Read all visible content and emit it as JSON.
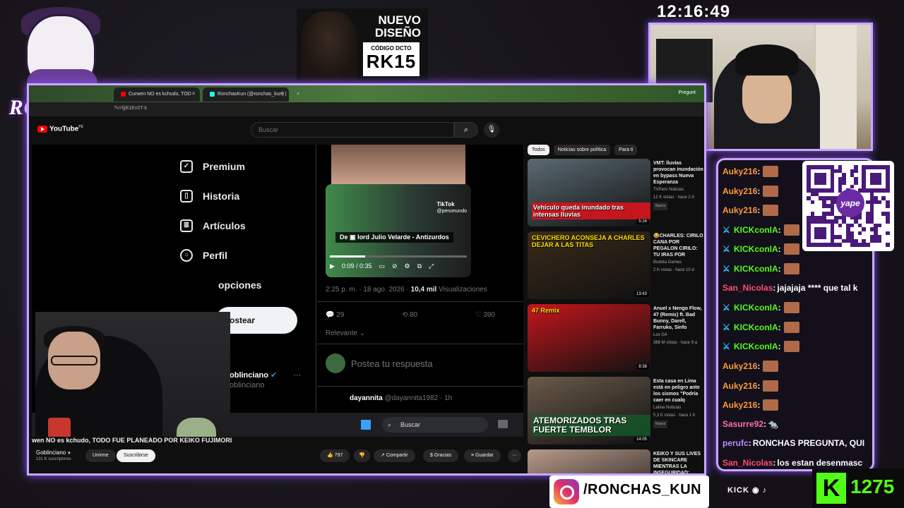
{
  "overlay": {
    "logo_text": "RONCHAS",
    "clock": "12:16:49",
    "ad": {
      "line1": "NUEVO",
      "line2": "DISEÑO",
      "code_label": "CÓDIGO DCTO",
      "code": "RK15"
    },
    "instagram_handle": "/RONCHAS_KUN",
    "socials_text": "KICK",
    "kick_count": "1275",
    "qr_brand": "yape"
  },
  "browser": {
    "tabs": [
      {
        "label": "Curwen NO es kchudo, TOD",
        "icon_color": "#ff0000"
      },
      {
        "label": "RonchasKun (@ronchas_kun) |",
        "icon_color": "#25f4ee"
      }
    ],
    "ask_label": "Pregunt",
    "url": "?v=fjjB1Eo0T-k"
  },
  "youtube": {
    "logo": "YouTube",
    "logo_suffix": "PE",
    "search_placeholder": "Buscar",
    "video_title": "wen NO es kchudo, TODO FUE PLANEADO POR KEIKO FUJIMORI",
    "channel": "Goblinciano",
    "subscribers": "131 K suscriptores",
    "join_label": "Unirme",
    "subscribe_label": "Suscribirse",
    "actions": [
      {
        "label": "797",
        "icon": "👍"
      },
      {
        "label": "",
        "icon": "👎"
      },
      {
        "label": "Compartir",
        "icon": "↗"
      },
      {
        "label": "Gracias",
        "icon": "$"
      },
      {
        "label": "Guardar",
        "icon": "≡"
      },
      {
        "label": "···",
        "icon": ""
      }
    ],
    "chips": [
      "Todos",
      "Noticias sobre política",
      "Para ti"
    ],
    "suggestions": [
      {
        "title": "VMT: lluvias provocan inundación en bypass Nueva Esperanza",
        "channel": "TVPerú Noticias",
        "meta": "12 K vistas · hace 2 d",
        "badge": "Nuevo",
        "duration": "5:16",
        "overlay": "Vehículo queda inundado tras intensas lluvias",
        "color": "#5a6a72"
      },
      {
        "title": "😂CHARLES: CIRILO CANA POR PEGALON CIRILO: TU IRAS POR",
        "channel": "Budota Games",
        "meta": "2 K vistas · hace 10 d",
        "badge": "",
        "duration": "13:43",
        "overlay": "CEVICHERO ACONSEJA A CHARLES DEJAR A LAS TITAS",
        "color": "#3a2a1a"
      },
      {
        "title": "Anuel x Nengo Flow, 47 (Remix) ft. Bad Bunny, Darell, Farruko, Sinfo",
        "channel": "Los G4",
        "meta": "368 M vistas · hace 9 a",
        "badge": "",
        "duration": "8:38",
        "overlay": "47 Remix",
        "color": "#c4161c"
      },
      {
        "title": "Esta casa en Lima está en peligro ante los sismos \"Podría caer en cualq",
        "channel": "Latina Noticias",
        "meta": "5,3 K vistas · hace 1 h",
        "badge": "Nuevo",
        "duration": "14:05",
        "overlay": "ATEMORIZADOS TRAS FUERTE TEMBLOR",
        "color": "#6a5a4a"
      },
      {
        "title": "KEIKO Y SUS LIVES DE SKINCARE MIENTRAS LA INSEGURIDAD: ...",
        "channel": "",
        "meta": "",
        "badge": "",
        "duration": "",
        "overlay": "",
        "color": "#b89a8a"
      }
    ]
  },
  "x_page": {
    "nav": [
      {
        "label": "Premium",
        "icon": "✓"
      },
      {
        "label": "Historia",
        "icon": "▯"
      },
      {
        "label": "Artículos",
        "icon": "≣"
      },
      {
        "label": "Perfil",
        "icon": "○"
      },
      {
        "label": "opciones",
        "icon": ""
      }
    ],
    "post_button": "ostear",
    "user_name": "oblinciano",
    "user_handle": "oblinciano",
    "video_caption": "lord Julio Velarde - Antizurdos",
    "video_caption_prefix": "De",
    "video_time": "0:09 / 0:35",
    "progress": 0.26,
    "tiktok_label": "TikTok",
    "tiktok_handle": "@perumundo",
    "timestamp": "2:25 p. m. · 18 ago. 2026 ·",
    "views_count": "10,4 mil",
    "views_label": "Visualizaciones",
    "stats": {
      "replies": "29",
      "retweets": "80",
      "likes": "390"
    },
    "relevant_label": "Relevante",
    "reply_placeholder": "Postea tu respuesta",
    "next_name": "dayannita",
    "next_handle": "@dayannita1982 · 1h",
    "taskbar_search": "Buscar"
  },
  "chat": {
    "messages": [
      {
        "user": "Auky216",
        "color": "#ff9a3c",
        "text": "",
        "emote": true,
        "mod": false
      },
      {
        "user": "Auky216",
        "color": "#ff9a3c",
        "text": "",
        "emote": true,
        "mod": false
      },
      {
        "user": "Auky216",
        "color": "#ff9a3c",
        "text": "",
        "emote": true,
        "mod": false
      },
      {
        "user": "KICKconIA",
        "color": "#53fc18",
        "text": "",
        "emote": true,
        "mod": true
      },
      {
        "user": "KICKconIA",
        "color": "#53fc18",
        "text": "",
        "emote": true,
        "mod": true
      },
      {
        "user": "KICKconIA",
        "color": "#53fc18",
        "text": "",
        "emote": true,
        "mod": true
      },
      {
        "user": "San_Nicolas",
        "color": "#ff4d6d",
        "text": "jajajaja **** que tal k",
        "emote": false,
        "mod": false
      },
      {
        "user": "KICKconIA",
        "color": "#53fc18",
        "text": "",
        "emote": true,
        "mod": true
      },
      {
        "user": "KICKconIA",
        "color": "#53fc18",
        "text": "",
        "emote": true,
        "mod": true
      },
      {
        "user": "KICKconIA",
        "color": "#53fc18",
        "text": "",
        "emote": true,
        "mod": true
      },
      {
        "user": "Auky216",
        "color": "#ff9a3c",
        "text": "",
        "emote": true,
        "mod": false
      },
      {
        "user": "Auky216",
        "color": "#ff9a3c",
        "text": "",
        "emote": true,
        "mod": false
      },
      {
        "user": "Auky216",
        "color": "#ff9a3c",
        "text": "",
        "emote": true,
        "mod": false
      },
      {
        "user": "Sasurre92",
        "color": "#ff6fa0",
        "text": "🐀",
        "emote": false,
        "mod": false
      },
      {
        "user": "perufc",
        "color": "#b78cff",
        "text": "RONCHAS PREGUNTA, QUI",
        "emote": false,
        "mod": false
      },
      {
        "user": "San_Nicolas",
        "color": "#ff4d6d",
        "text": "los estan desenmasc",
        "emote": false,
        "mod": false
      }
    ]
  },
  "colors": {
    "accent": "#c9a7ff",
    "kick_green": "#53fc18"
  }
}
